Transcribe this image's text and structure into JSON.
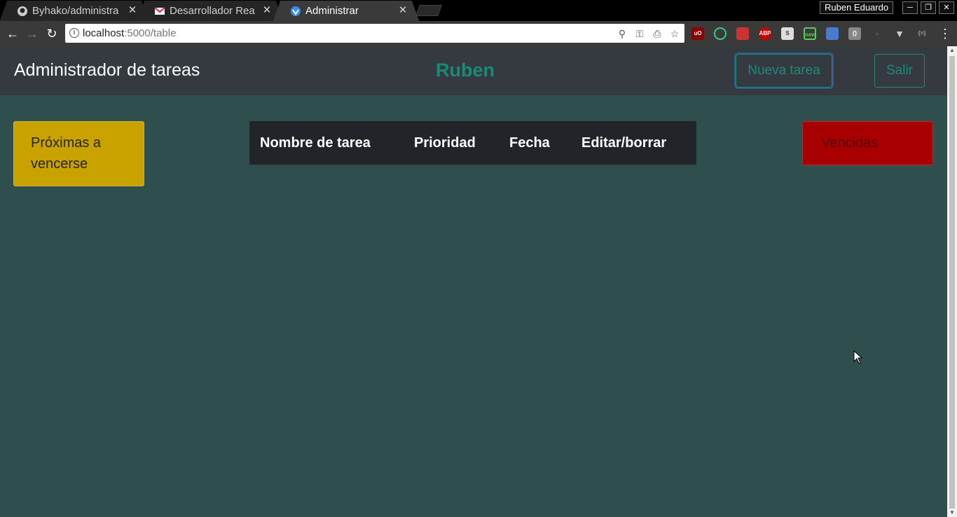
{
  "browser": {
    "tabs": [
      {
        "title": "Byhako/administra",
        "favicon": "github-icon"
      },
      {
        "title": "Desarrollador Rea",
        "favicon": "gmail-icon"
      },
      {
        "title": "Administrar",
        "favicon": "app-favicon"
      }
    ],
    "profile_name": "Ruben Eduardo",
    "url_host": "localhost",
    "url_path": ":5000/table",
    "extensions": [
      "ublock-icon",
      "target-icon",
      "gift-icon",
      "adblock-plus-icon",
      "skype-icon",
      "new-badge-icon",
      "bookmark-icon",
      "bracket-icon",
      "hat-icon",
      "vuetify-icon",
      "json-icon"
    ]
  },
  "navbar": {
    "brand": "Administrador de tareas",
    "username": "Ruben",
    "new_task_label": "Nueva tarea",
    "logout_label": "Salir"
  },
  "cards": {
    "soon_label": "Próximas a vencerse",
    "overdue_label": "Vencidas"
  },
  "table": {
    "headers": [
      "Nombre de tarea",
      "Prioridad",
      "Fecha",
      "Editar/borrar"
    ]
  },
  "colors": {
    "page_bg": "#2f4f4f",
    "navbar_bg": "#343a40",
    "accent": "#1f8a7b",
    "warning": "#c9a200",
    "danger": "#a80000",
    "table_header": "#212529"
  }
}
